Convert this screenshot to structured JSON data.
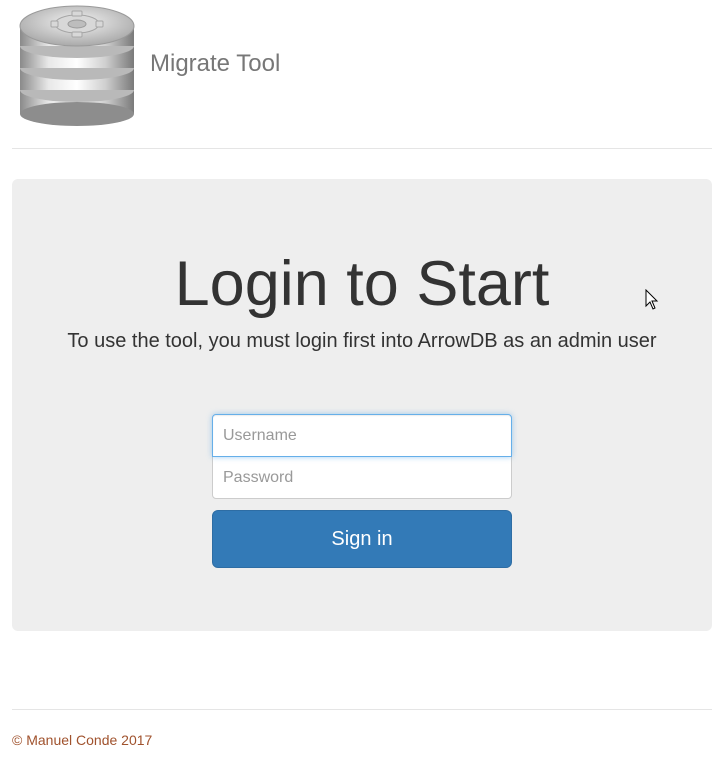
{
  "header": {
    "logo_icon": "database-gear-icon",
    "app_title": "Migrate Tool"
  },
  "jumbotron": {
    "title": "Login to Start",
    "lead": "To use the tool, you must login first into ArrowDB as an admin user"
  },
  "login_form": {
    "username": {
      "value": "",
      "placeholder": "Username"
    },
    "password": {
      "value": "",
      "placeholder": "Password"
    },
    "submit_label": "Sign in"
  },
  "footer": {
    "text": "© Manuel Conde 2017"
  },
  "colors": {
    "primary_button": "#337ab7",
    "jumbotron_bg": "#eeeeee",
    "footer_text": "#a0522d",
    "focus_border": "#66afe9"
  }
}
